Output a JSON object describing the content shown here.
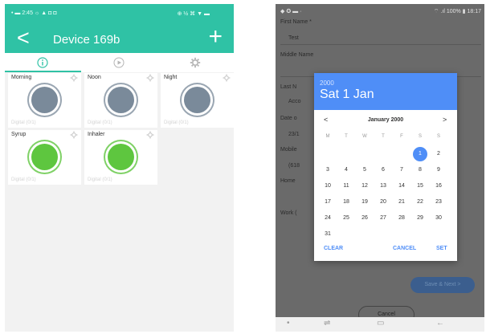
{
  "left_phone": {
    "status_bar": {
      "left_text": "• ▬ 2:45  ☼ ▲ ◘ ◘",
      "right_text": "⊕ ½ ⌘ ▼ ▬"
    },
    "header": {
      "title": "Device 169b",
      "back_icon": "chevron-left-icon",
      "add_icon": "plus-icon"
    },
    "tabs": [
      "info-icon",
      "play-icon",
      "gear-icon"
    ],
    "accent_color": "#2fc2a5",
    "cards": [
      {
        "name": "Morning",
        "status": "Digital (0/1)",
        "color": "grey"
      },
      {
        "name": "Noon",
        "status": "Digital (0/1)",
        "color": "grey"
      },
      {
        "name": "Night",
        "status": "Digital (0/1)",
        "color": "grey"
      },
      {
        "name": "Syrup",
        "status": "Digital (0/1)",
        "color": "green"
      },
      {
        "name": "Inhaler",
        "status": "Digital (0/1)",
        "color": "green"
      }
    ]
  },
  "right_phone": {
    "status_bar": {
      "left_text": "◆ ✪ ▬ ·",
      "right_text": "⌔ .ıl 100% ▮ 18:17"
    },
    "form": {
      "first_name_label": "First Name *",
      "first_name_value": "Test",
      "middle_name_label": "Middle Name",
      "last_name_label": "Last N",
      "last_name_value": "Acco",
      "date_label": "Date o",
      "date_value": "23/1",
      "mobile_label": "Mobile",
      "mobile_value": "(618",
      "home_label": "Home",
      "work_label": "Work (",
      "next_button": "Save & Next >",
      "cancel_button": "Cancel"
    },
    "date_picker": {
      "year": "2000",
      "selected_date": "Sat 1 Jan",
      "month": "January 2000",
      "prev": "<",
      "next": ">",
      "weekdays": [
        "M",
        "T",
        "W",
        "T",
        "F",
        "S",
        "S"
      ],
      "days": [
        "1",
        "2",
        "3",
        "4",
        "5",
        "6",
        "7",
        "8",
        "9",
        "10",
        "11",
        "12",
        "13",
        "14",
        "15",
        "16",
        "17",
        "18",
        "19",
        "20",
        "21",
        "22",
        "23",
        "24",
        "25",
        "26",
        "27",
        "28",
        "29",
        "30",
        "31"
      ],
      "selected_day": "1",
      "clear": "CLEAR",
      "cancel": "CANCEL",
      "set": "SET",
      "header_color": "#4f8ef7"
    },
    "nav_bar": [
      "back-icon",
      "recents-icon",
      "home-icon",
      "back-arrow-icon"
    ]
  }
}
